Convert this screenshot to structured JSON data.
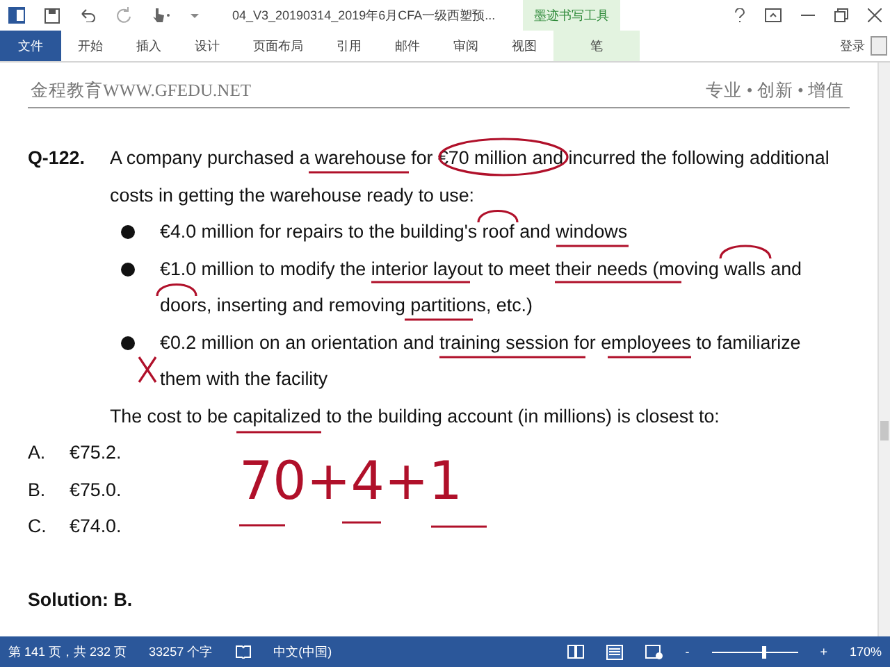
{
  "title_bar": {
    "title": "04_V3_20190314_2019年6月CFA一级西塑预...",
    "context_group": "墨迹书写工具"
  },
  "ribbon_tabs": [
    {
      "label": "文件",
      "kind": "file"
    },
    {
      "label": "开始",
      "kind": "normal"
    },
    {
      "label": "插入",
      "kind": "normal"
    },
    {
      "label": "设计",
      "kind": "normal"
    },
    {
      "label": "页面布局",
      "kind": "normal"
    },
    {
      "label": "引用",
      "kind": "normal"
    },
    {
      "label": "邮件",
      "kind": "normal"
    },
    {
      "label": "审阅",
      "kind": "normal"
    },
    {
      "label": "视图",
      "kind": "normal"
    },
    {
      "label": "笔",
      "kind": "context"
    }
  ],
  "sign_in": "登录",
  "page_header": {
    "left": "金程教育WWW.GFEDU.NET",
    "right": "专业 • 创新 • 增值"
  },
  "question": {
    "number": "Q-122.",
    "text": "A company purchased a warehouse for €70 million and incurred the following additional costs in getting the warehouse ready to use:",
    "bullets": [
      "€4.0 million for repairs to the building's roof and windows",
      "€1.0 million to modify the interior layout to meet their needs (moving walls and doors, inserting and removing partitions, etc.)",
      "€0.2 million on an orientation and training session for employees to familiarize them with the facility"
    ],
    "prompt": "The cost to be capitalized to the building account (in millions) is closest to:"
  },
  "options": [
    {
      "letter": "A.",
      "text": "€75.2."
    },
    {
      "letter": "B.",
      "text": "€75.0."
    },
    {
      "letter": "C.",
      "text": "€74.0."
    }
  ],
  "solution": "Solution: B.",
  "handwriting": "70+4+1",
  "status_bar": {
    "page": "第 141 页，共 232 页",
    "words": "33257 个字",
    "language": "中文(中国)",
    "zoom_minus": "-",
    "zoom_plus": "+",
    "zoom": {
      "level": 0.6
    },
    "zoom_text": "170%"
  }
}
